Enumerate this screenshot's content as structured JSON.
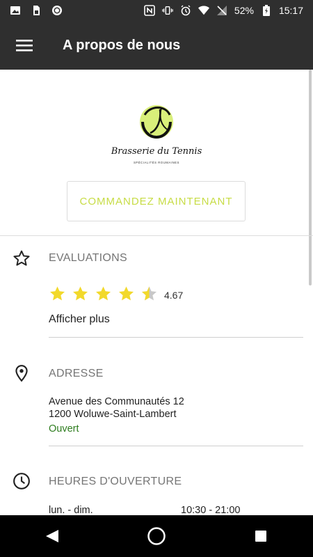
{
  "status_bar": {
    "battery": "52%",
    "time": "15:17"
  },
  "app_bar": {
    "title": "A propos de nous"
  },
  "logo": {
    "name": "Brasserie du Tennis",
    "tagline": "SPÉCIALITÉS ROUMAINES"
  },
  "order_button": {
    "label": "COMMANDEZ MAINTENANT"
  },
  "ratings": {
    "title": "EVALUATIONS",
    "value": "4.67",
    "stars": 4.67,
    "show_more": "Afficher plus",
    "star_color": "#f2d92b"
  },
  "address": {
    "title": "ADRESSE",
    "line1": "Avenue des Communautés 12",
    "line2": "1200 Woluwe-Saint-Lambert",
    "status": "Ouvert",
    "status_color": "#2e7d1f"
  },
  "hours": {
    "title": "HEURES D'OUVERTURE",
    "rows": [
      {
        "days": "lun. - dim.",
        "time": "10:30 - 21:00"
      }
    ]
  },
  "colors": {
    "accent": "#c7dc45",
    "bar": "#2f2f2f"
  }
}
